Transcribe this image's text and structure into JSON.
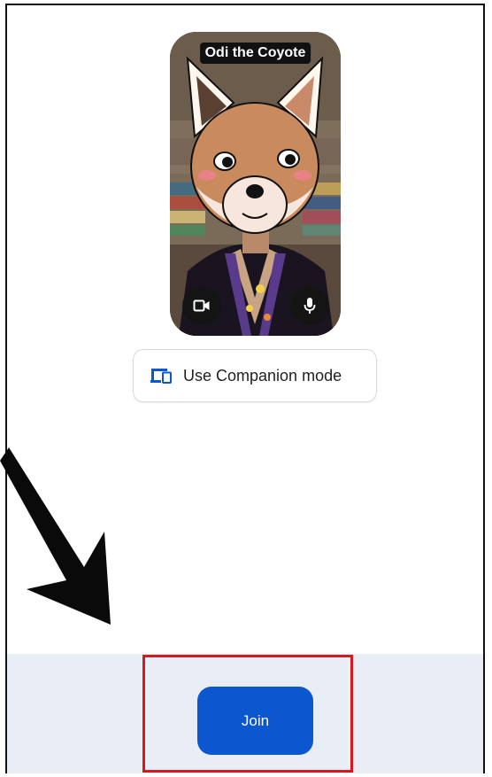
{
  "preview": {
    "participant_name": "Odi the Coyote",
    "camera_icon": "camera-icon",
    "mic_icon": "mic-icon"
  },
  "companion": {
    "icon": "devices-icon",
    "label": "Use Companion mode"
  },
  "join": {
    "label": "Join"
  },
  "colors": {
    "primary": "#0b57d0",
    "bottom_bar": "#e8edf6",
    "highlight": "#d7191f"
  }
}
